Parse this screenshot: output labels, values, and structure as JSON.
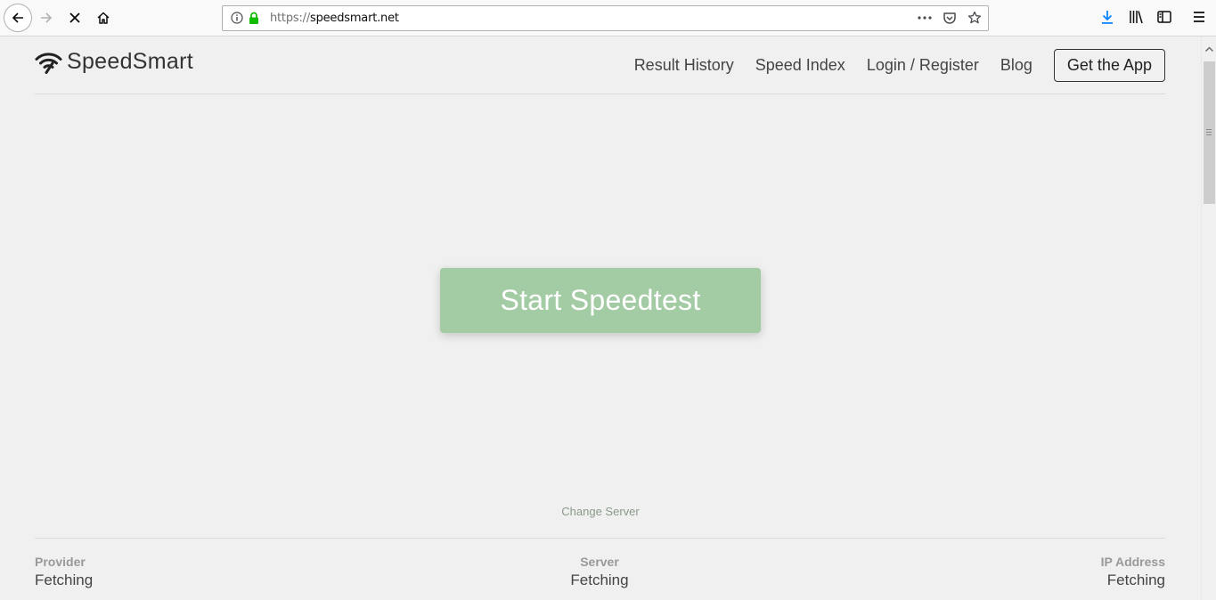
{
  "browser": {
    "url_scheme": "https://",
    "url_host": "speedsmart.net",
    "icons": [
      "back-icon",
      "forward-icon",
      "stop-icon",
      "home-icon",
      "info-icon",
      "lock-icon",
      "page-actions-icon",
      "pocket-icon",
      "bookmark-star-icon",
      "download-icon",
      "library-icon",
      "sidebar-icon",
      "menu-icon"
    ]
  },
  "site": {
    "logo_text": "SpeedSmart",
    "nav": {
      "result_history": "Result History",
      "speed_index": "Speed Index",
      "login_register": "Login / Register",
      "blog": "Blog",
      "get_app": "Get the App"
    },
    "start_button": "Start Speedtest",
    "change_server": "Change Server",
    "info": {
      "provider_label": "Provider",
      "provider_value": "Fetching",
      "server_label": "Server",
      "server_value": "Fetching",
      "ip_label": "IP Address",
      "ip_value": "Fetching"
    }
  },
  "colors": {
    "start_button": "#a3cba4",
    "background": "#f0f0f0",
    "lock_green": "#12bc00"
  }
}
